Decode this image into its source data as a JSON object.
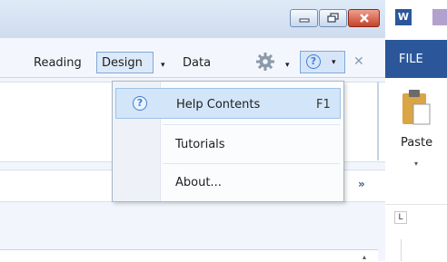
{
  "toolbar": {
    "tabs": [
      {
        "label": "Reading"
      },
      {
        "label": "Design"
      },
      {
        "label": "Data"
      }
    ],
    "dropdown_glyph": "▾",
    "close_glyph": "✕",
    "help_glyph": "?"
  },
  "window_controls": {
    "icons": [
      "minimize-icon",
      "restore-icon",
      "close-icon"
    ]
  },
  "help_menu": {
    "items": [
      {
        "label": "Help Contents",
        "shortcut": "F1",
        "icon": "help-icon",
        "icon_glyph": "?"
      },
      {
        "label": "Tutorials"
      },
      {
        "label": "About..."
      }
    ]
  },
  "panel": {
    "chevron_glyph": "»",
    "scroll_glyph": "▴"
  },
  "word": {
    "logo_text": "W",
    "ribbon_tab": "FILE",
    "paste_label": "Paste",
    "paste_arrow": "▾",
    "ruler_glyph": "L",
    "accent": "#2b579a"
  },
  "colors": {
    "selection": "#d3e5f8",
    "close_button": "#c4422a"
  }
}
